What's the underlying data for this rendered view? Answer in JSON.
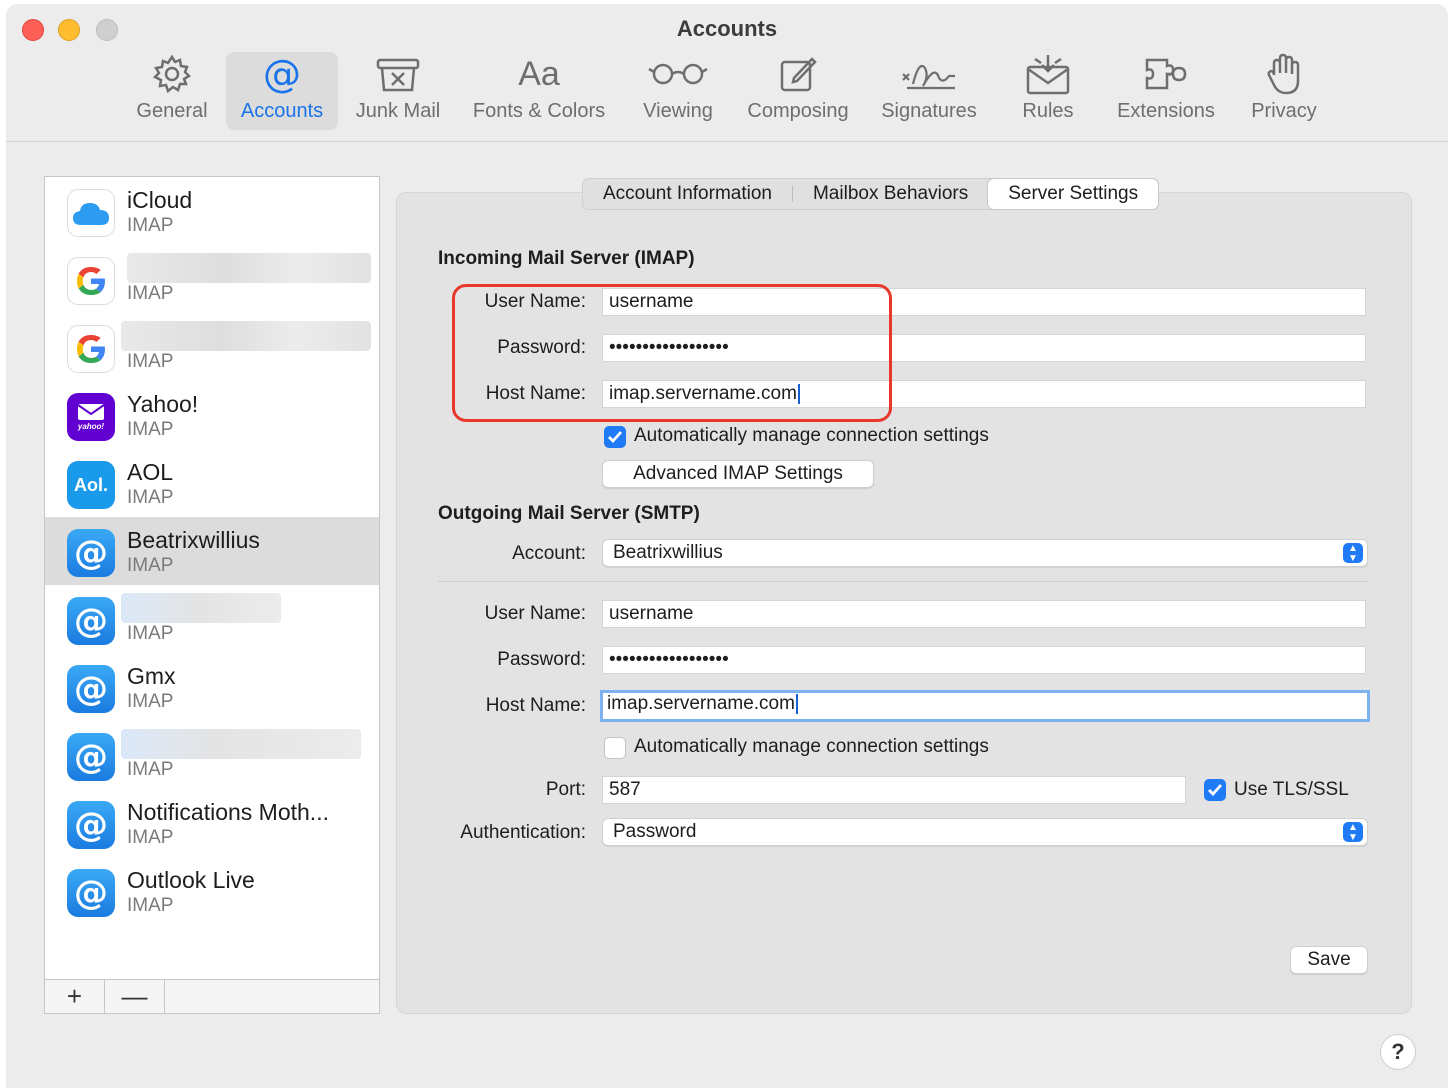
{
  "window": {
    "title": "Accounts"
  },
  "toolbar": [
    {
      "label": "General",
      "icon": "gear-icon"
    },
    {
      "label": "Accounts",
      "icon": "at-icon"
    },
    {
      "label": "Junk Mail",
      "icon": "junk-mail-icon"
    },
    {
      "label": "Fonts & Colors",
      "icon": "fonts-icon"
    },
    {
      "label": "Viewing",
      "icon": "glasses-icon"
    },
    {
      "label": "Composing",
      "icon": "compose-icon"
    },
    {
      "label": "Signatures",
      "icon": "signature-icon"
    },
    {
      "label": "Rules",
      "icon": "rules-icon"
    },
    {
      "label": "Extensions",
      "icon": "extensions-icon"
    },
    {
      "label": "Privacy",
      "icon": "hand-icon"
    }
  ],
  "fonts_glyph": "Aa",
  "accounts": [
    {
      "name": "iCloud",
      "type": "IMAP",
      "icon": "icloud-icon"
    },
    {
      "name": "",
      "type": "IMAP",
      "icon": "google-icon"
    },
    {
      "name": "",
      "type": "IMAP",
      "icon": "google-icon"
    },
    {
      "name": "Yahoo!",
      "type": "IMAP",
      "icon": "yahoo-icon",
      "icon_text": "yahoo!"
    },
    {
      "name": "AOL",
      "type": "IMAP",
      "icon": "aol-icon",
      "icon_text": "Aol."
    },
    {
      "name": "Beatrixwillius",
      "type": "IMAP",
      "icon": "at-icon"
    },
    {
      "name": "",
      "type": "IMAP",
      "icon": "at-icon"
    },
    {
      "name": "Gmx",
      "type": "IMAP",
      "icon": "at-icon"
    },
    {
      "name": "",
      "type": "IMAP",
      "icon": "at-icon"
    },
    {
      "name": "Notifications Moth...",
      "type": "IMAP",
      "icon": "at-icon"
    },
    {
      "name": "Outlook Live",
      "type": "IMAP",
      "icon": "at-icon"
    }
  ],
  "list_footer": {
    "add": "+",
    "remove": "—"
  },
  "tabs": [
    "Account Information",
    "Mailbox Behaviors",
    "Server Settings"
  ],
  "incoming": {
    "heading": "Incoming Mail Server (IMAP)",
    "username_label": "User Name:",
    "username": "username",
    "password_label": "Password:",
    "password": "••••••••••••••••••",
    "host_label": "Host Name:",
    "host": "imap.servername.com",
    "auto_label": "Automatically manage connection settings",
    "auto_checked": true,
    "advanced_button": "Advanced IMAP Settings"
  },
  "outgoing": {
    "heading": "Outgoing Mail Server (SMTP)",
    "account_label": "Account:",
    "account": "Beatrixwillius",
    "username_label": "User Name:",
    "username": "username",
    "password_label": "Password:",
    "password": "••••••••••••••••••",
    "host_label": "Host Name:",
    "host": "imap.servername.com",
    "auto_label": "Automatically manage connection settings",
    "auto_checked": false,
    "port_label": "Port:",
    "port": "587",
    "tls_label": "Use TLS/SSL",
    "tls_checked": true,
    "auth_label": "Authentication:",
    "auth": "Password"
  },
  "save_button": "Save",
  "help_button": "?",
  "colors": {
    "accent": "#1f7af5",
    "highlight_annotation": "#e8382c",
    "traffic_red": "#fe5f57",
    "traffic_yellow": "#febc2e"
  }
}
